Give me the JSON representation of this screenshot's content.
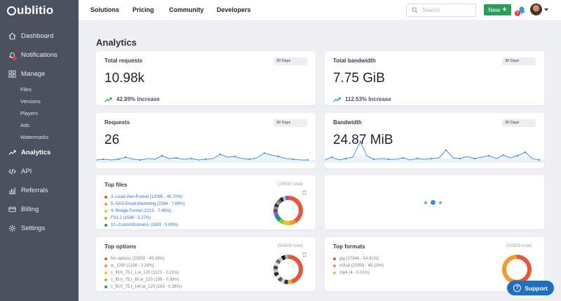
{
  "app": {
    "logo_text": "ublitio"
  },
  "top_nav": [
    "Solutions",
    "Pricing",
    "Community",
    "Developers"
  ],
  "search": {
    "placeholder": "Search"
  },
  "new_button": {
    "label": "New",
    "icon": "plus-icon"
  },
  "notifications_badge": "0",
  "sidebar": {
    "items": [
      {
        "label": "Dashboard",
        "icon": "home-icon"
      },
      {
        "label": "Notifications",
        "icon": "bell-icon"
      },
      {
        "label": "Manage",
        "icon": "grid-icon"
      },
      {
        "label": "Analytics",
        "icon": "trend-icon"
      },
      {
        "label": "API",
        "icon": "code-icon"
      },
      {
        "label": "Referrals",
        "icon": "chart-bars-icon"
      },
      {
        "label": "Billing",
        "icon": "card-icon"
      },
      {
        "label": "Settings",
        "icon": "gear-icon"
      }
    ],
    "manage_sub": [
      "Files",
      "Versions",
      "Players",
      "Ads",
      "Watermarks"
    ],
    "active": "Analytics"
  },
  "page": {
    "title": "Analytics"
  },
  "cards": {
    "total_requests": {
      "title": "Total requests",
      "period": "30 Days",
      "value": "10.98k",
      "change": "42.89% Increase"
    },
    "total_bandwidth": {
      "title": "Total bandwidth",
      "period": "30 Days",
      "value": "7.75 GiB",
      "change": "112.53% Increase"
    },
    "requests": {
      "title": "Requests",
      "period": "30 Days",
      "value": "26"
    },
    "bandwidth": {
      "title": "Bandwidth",
      "period": "30 Days",
      "value": "24.87 MiB"
    },
    "top_files": {
      "title": "Top files",
      "total": "(29692 total)",
      "items": [
        {
          "label": "3.-Lead-Gen-Funnel (12085 - 40.70%)",
          "color": "#e8553a",
          "pct": 40.7
        },
        {
          "label": "5.-SAS-Email-Marketing (2284 - 7.69%)",
          "color": "#f39a2b",
          "pct": 7.69
        },
        {
          "label": "4.-Bridge-Funnel (2215 - 7.46%)",
          "color": "#f2c21b",
          "pct": 7.46
        },
        {
          "label": "FS1.2 (1566 - 5.27%)",
          "color": "#8cc63f",
          "pct": 5.27
        },
        {
          "label": "10.-CustomDomains (1509 - 5.08%)",
          "color": "#1f9e4a",
          "pct": 5.08
        }
      ]
    },
    "top_options": {
      "title": "Top options",
      "total": "(50809 total)",
      "items": [
        {
          "label": "No options (22959 - 45.19%)",
          "color": "#e8553a",
          "pct": 45.19
        },
        {
          "label": "w_1280 (1158 - 2.28%)",
          "color": "#f39a2b",
          "pct": 2.28
        },
        {
          "label": "c_fill,h_75,t_1,w_120 (1121 - 2.21%)",
          "color": "#f2c21b",
          "pct": 2.21
        },
        {
          "label": "c_fill,h_75,t_80,w_120 (199 - 0.39%)",
          "color": "#8cc63f",
          "pct": 0.39
        },
        {
          "label": "c_fill,h_75,t_140,w_120 (193 - 0.38%)",
          "color": "#1f9e4a",
          "pct": 0.38
        }
      ]
    },
    "top_formats": {
      "title": "Top formats",
      "total": "(50809 total)",
      "items": [
        {
          "label": "jpg (27846 - 54.81%)",
          "color": "#e8553a",
          "pct": 54.81
        },
        {
          "label": "m3u8 (22959 - 45.19%)",
          "color": "#f39a2b",
          "pct": 45.19
        },
        {
          "label": "mp4 (4 - 0.01%)",
          "color": "#f2c21b",
          "pct": 0.01
        }
      ]
    }
  },
  "support": {
    "label": "Support"
  },
  "colors": {
    "sidebar": "#4a5260",
    "accent_green": "#2a9d5c",
    "chart_line": "#4a90d9",
    "support_button": "#1f6fbf"
  }
}
